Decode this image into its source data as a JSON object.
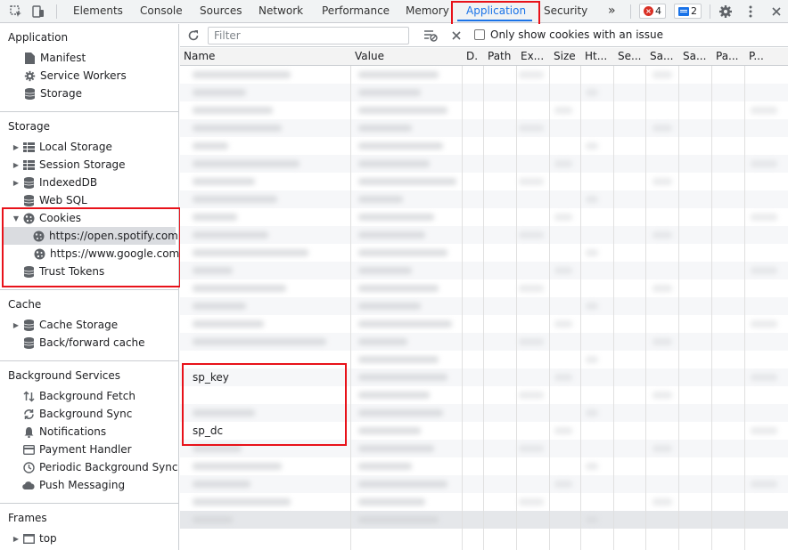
{
  "topbar": {
    "tabs": [
      "Elements",
      "Console",
      "Sources",
      "Network",
      "Performance",
      "Memory",
      "Application",
      "Security"
    ],
    "more_label": "»",
    "error_count": "4",
    "message_count": "2"
  },
  "sidebar": {
    "application": {
      "title": "Application",
      "items": [
        "Manifest",
        "Service Workers",
        "Storage"
      ]
    },
    "storage": {
      "title": "Storage",
      "items": [
        "Local Storage",
        "Session Storage",
        "IndexedDB",
        "Web SQL",
        "Cookies"
      ],
      "cookie_sites": [
        "https://open.spotify.com",
        "https://www.google.com"
      ],
      "trust_tokens": "Trust Tokens"
    },
    "cache": {
      "title": "Cache",
      "items": [
        "Cache Storage",
        "Back/forward cache"
      ]
    },
    "background": {
      "title": "Background Services",
      "items": [
        "Background Fetch",
        "Background Sync",
        "Notifications",
        "Payment Handler",
        "Periodic Background Sync",
        "Push Messaging"
      ]
    },
    "frames": {
      "title": "Frames",
      "items": [
        "top"
      ]
    }
  },
  "toolbar": {
    "filter_placeholder": "Filter",
    "only_issues_label": "Only show cookies with an issue"
  },
  "table": {
    "columns": [
      "Name",
      "Value",
      "D.",
      "Path",
      "Ex...",
      "Size",
      "Ht...",
      "Se...",
      "Sa...",
      "Sa...",
      "Pa...",
      "P..."
    ],
    "visible_rows": [
      {
        "name": "sp_key"
      },
      {
        "name": "sp_dc"
      }
    ]
  },
  "colors": {
    "accent": "#1a73e8",
    "highlight": "#e8121a",
    "error": "#d93025"
  }
}
